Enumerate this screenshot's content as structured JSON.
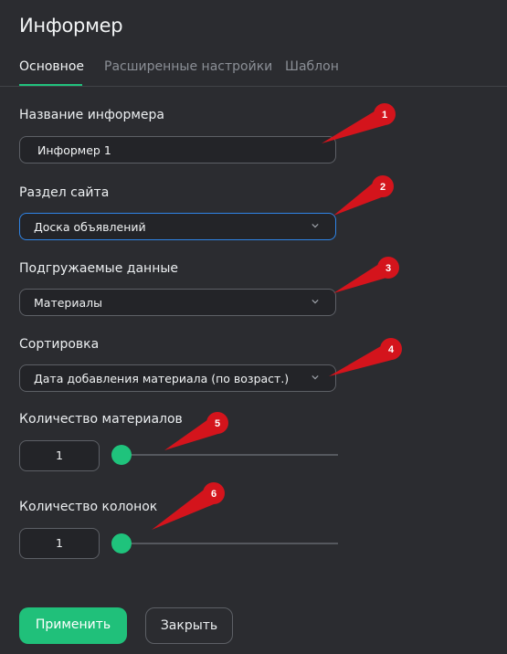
{
  "dialog": {
    "title": "Информер"
  },
  "tabs": [
    {
      "label": "Основное",
      "active": true
    },
    {
      "label": "Расширенные настройки",
      "active": false
    },
    {
      "label": "Шаблон",
      "active": false
    }
  ],
  "form": {
    "name": {
      "label": "Название информера",
      "value": "Информер 1"
    },
    "section": {
      "label": "Раздел сайта",
      "value": "Доска объявлений",
      "icon": "chevron-down-icon"
    },
    "data_source": {
      "label": "Подгружаемые данные",
      "value": "Материалы",
      "icon": "chevron-down-icon"
    },
    "sorting": {
      "label": "Сортировка",
      "value": "Дата добавления материала (по возраст.)",
      "icon": "chevron-down-icon"
    },
    "materials_count": {
      "label": "Количество материалов",
      "value": "1",
      "slider_level": 0
    },
    "columns_count": {
      "label": "Количество колонок",
      "value": "1",
      "slider_level": 0
    }
  },
  "buttons": {
    "apply": "Применить",
    "close": "Закрыть"
  },
  "annotations": [
    "1",
    "2",
    "3",
    "4",
    "5",
    "6"
  ],
  "colors": {
    "background": "#2b2c30",
    "accent": "#21c27d",
    "focus_border": "#2f84e6",
    "annotation": "#d4141c"
  }
}
